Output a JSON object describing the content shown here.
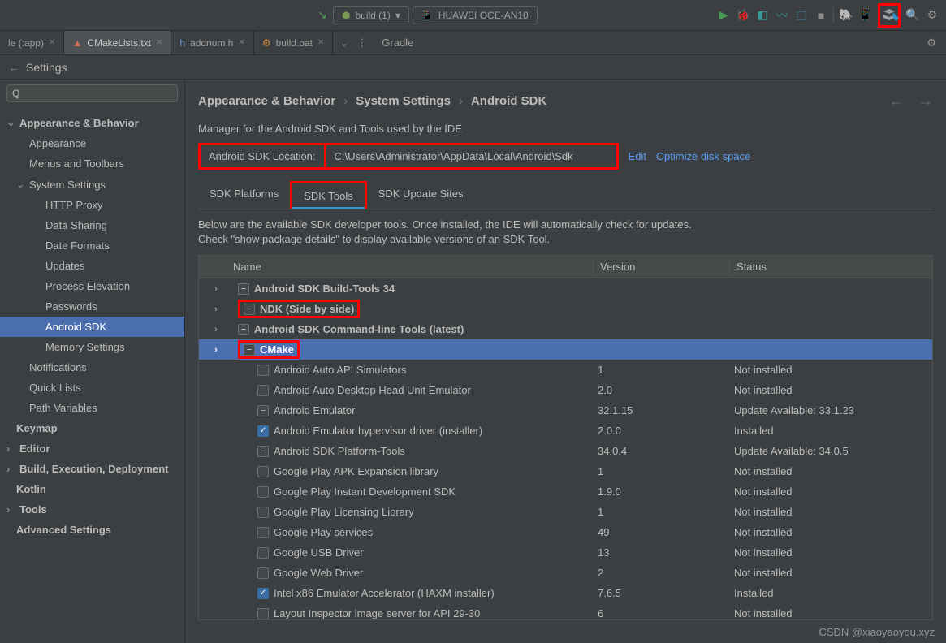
{
  "topbar": {
    "build_config": "build (1)",
    "device": "HUAWEI OCE-AN10"
  },
  "tabs": {
    "t0": "le (:app)",
    "t1": "CMakeLists.txt",
    "t2": "addnum.h",
    "t3": "build.bat"
  },
  "crumb": {
    "label": "Gradle"
  },
  "settings_title": "Settings",
  "sidebar_search_placeholder": "",
  "sidebar": {
    "s0": "Appearance & Behavior",
    "s1": "Appearance",
    "s2": "Menus and Toolbars",
    "s3": "System Settings",
    "s4": "HTTP Proxy",
    "s5": "Data Sharing",
    "s6": "Date Formats",
    "s7": "Updates",
    "s8": "Process Elevation",
    "s9": "Passwords",
    "s10": "Android SDK",
    "s11": "Memory Settings",
    "s12": "Notifications",
    "s13": "Quick Lists",
    "s14": "Path Variables",
    "s15": "Keymap",
    "s16": "Editor",
    "s17": "Build, Execution, Deployment",
    "s18": "Kotlin",
    "s19": "Tools",
    "s20": "Advanced Settings"
  },
  "bc": {
    "a": "Appearance & Behavior",
    "b": "System Settings",
    "c": "Android SDK"
  },
  "desc": "Manager for the Android SDK and Tools used by the IDE",
  "loc": {
    "label": "Android SDK Location:",
    "path": "C:\\Users\\Administrator\\AppData\\Local\\Android\\Sdk"
  },
  "links": {
    "edit": "Edit",
    "optimize": "Optimize disk space"
  },
  "sdktabs": {
    "a": "SDK Platforms",
    "b": "SDK Tools",
    "c": "SDK Update Sites"
  },
  "subdesc": "Below are the available SDK developer tools. Once installed, the IDE will automatically check for updates. Check \"show package details\" to display available versions of an SDK Tool.",
  "thead": {
    "name": "Name",
    "ver": "Version",
    "stat": "Status"
  },
  "rows": {
    "r0": {
      "name": "Android SDK Build-Tools 34",
      "ver": "",
      "stat": ""
    },
    "r1": {
      "name": "NDK (Side by side)",
      "ver": "",
      "stat": ""
    },
    "r2": {
      "name": "Android SDK Command-line Tools (latest)",
      "ver": "",
      "stat": ""
    },
    "r3": {
      "name": "CMake",
      "ver": "",
      "stat": ""
    },
    "r4": {
      "name": "Android Auto API Simulators",
      "ver": "1",
      "stat": "Not installed"
    },
    "r5": {
      "name": "Android Auto Desktop Head Unit Emulator",
      "ver": "2.0",
      "stat": "Not installed"
    },
    "r6": {
      "name": "Android Emulator",
      "ver": "32.1.15",
      "stat": "Update Available: 33.1.23"
    },
    "r7": {
      "name": "Android Emulator hypervisor driver (installer)",
      "ver": "2.0.0",
      "stat": "Installed"
    },
    "r8": {
      "name": "Android SDK Platform-Tools",
      "ver": "34.0.4",
      "stat": "Update Available: 34.0.5"
    },
    "r9": {
      "name": "Google Play APK Expansion library",
      "ver": "1",
      "stat": "Not installed"
    },
    "r10": {
      "name": "Google Play Instant Development SDK",
      "ver": "1.9.0",
      "stat": "Not installed"
    },
    "r11": {
      "name": "Google Play Licensing Library",
      "ver": "1",
      "stat": "Not installed"
    },
    "r12": {
      "name": "Google Play services",
      "ver": "49",
      "stat": "Not installed"
    },
    "r13": {
      "name": "Google USB Driver",
      "ver": "13",
      "stat": "Not installed"
    },
    "r14": {
      "name": "Google Web Driver",
      "ver": "2",
      "stat": "Not installed"
    },
    "r15": {
      "name": "Intel x86 Emulator Accelerator (HAXM installer)",
      "ver": "7.6.5",
      "stat": "Installed"
    },
    "r16": {
      "name": "Layout Inspector image server for API 29-30",
      "ver": "6",
      "stat": "Not installed"
    }
  },
  "watermark": "CSDN @xiaoyaoyou.xyz"
}
